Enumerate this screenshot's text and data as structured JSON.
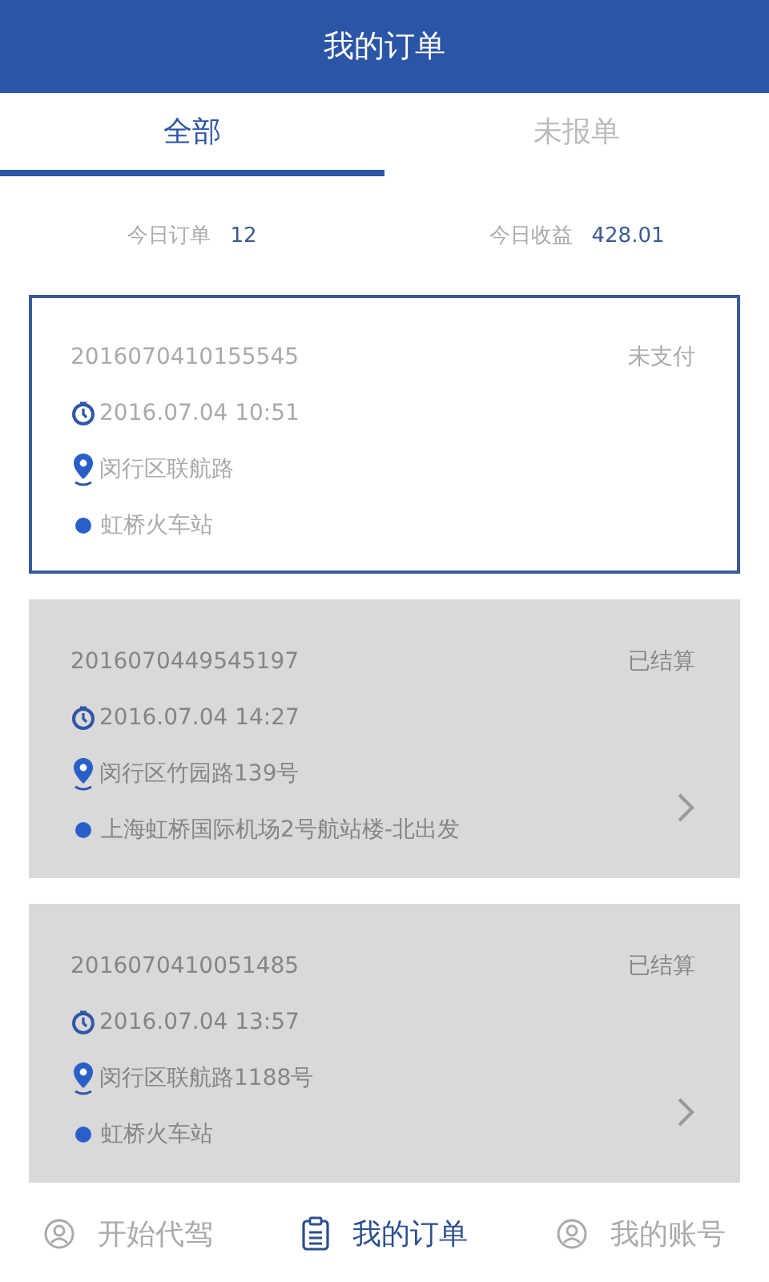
{
  "header": {
    "title": "我的订单"
  },
  "tabs": [
    {
      "label": "全部",
      "selected": true
    },
    {
      "label": "未报单",
      "selected": false
    }
  ],
  "stats": [
    {
      "label": "今日订单",
      "value": "12"
    },
    {
      "label": "今日收益",
      "value": "428.01"
    }
  ],
  "orders": [
    {
      "number": "2016070410155545",
      "status": "未支付",
      "time": "2016.07.04 10:51",
      "from": "闵行区联航路",
      "to": "虹桥火车站",
      "selected": true,
      "arrow": false
    },
    {
      "number": "2016070449545197",
      "status": "已结算",
      "time": "2016.07.04 14:27",
      "from": "闵行区竹园路139号",
      "to": "上海虹桥国际机场2号航站楼-北出发",
      "selected": false,
      "arrow": true
    },
    {
      "number": "2016070410051485",
      "status": "已结算",
      "time": "2016.07.04 13:57",
      "from": "闵行区联航路1188号",
      "to": "虹桥火车站",
      "selected": false,
      "arrow": true
    }
  ],
  "nav": [
    {
      "label": "开始代驾",
      "kind": "person",
      "selected": false
    },
    {
      "label": "我的订单",
      "kind": "clipboard",
      "selected": true
    },
    {
      "label": "我的账号",
      "kind": "person",
      "selected": false
    }
  ]
}
